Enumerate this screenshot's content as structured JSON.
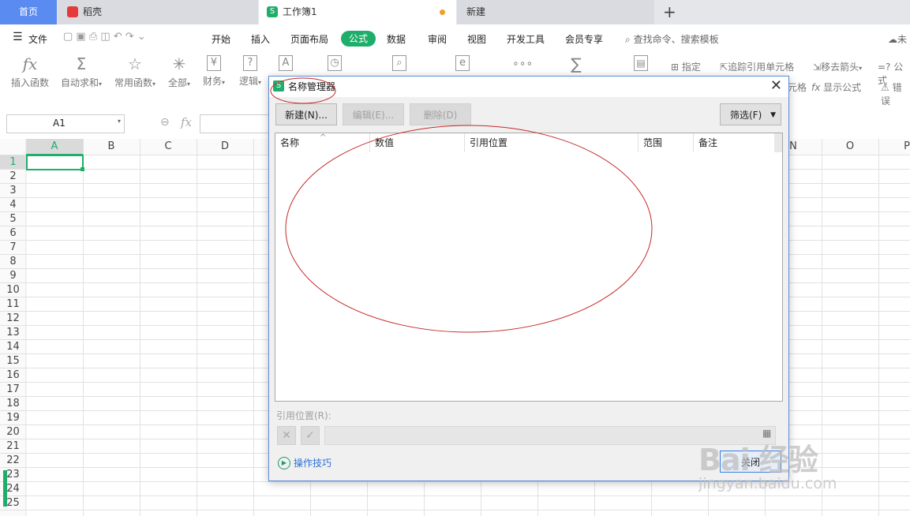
{
  "tabs": {
    "home": "首页",
    "docer": "稻壳",
    "workbook": "工作簿1",
    "new": "新建",
    "add": "+"
  },
  "menu": {
    "file": "文件",
    "items": [
      "开始",
      "插入",
      "页面布局",
      "公式",
      "数据",
      "审阅",
      "视图",
      "开发工具",
      "会员专享"
    ],
    "search": "查找命令、搜索模板",
    "cloud": "未"
  },
  "ribbon": {
    "insert_func": "插入函数",
    "autosum": "自动求和",
    "common_func": "常用函数",
    "all": "全部",
    "finance": "财务",
    "logic": "逻辑",
    "specify": "指定",
    "trace_precedents": "追踪引用单元格",
    "trace_dependents": "元格",
    "remove_arrows": "移去箭头",
    "formula_equals": "=? 公式",
    "show_formulas": "显示公式",
    "error": "错误"
  },
  "formula_bar": {
    "namebox": "A1",
    "fx": "fx"
  },
  "grid": {
    "columns": [
      "A",
      "B",
      "C",
      "D",
      "N",
      "O",
      "P"
    ],
    "rows": [
      "1",
      "2",
      "3",
      "4",
      "5",
      "6",
      "7",
      "8",
      "9",
      "10",
      "11",
      "12",
      "13",
      "14",
      "15",
      "16",
      "17",
      "18",
      "19",
      "20",
      "21",
      "22",
      "23",
      "24",
      "25"
    ]
  },
  "dialog": {
    "title": "名称管理器",
    "new": "新建(N)...",
    "edit": "编辑(E)...",
    "delete": "删除(D)",
    "filter": "筛选(F)",
    "columns": [
      "名称",
      "数值",
      "引用位置",
      "范围",
      "备注"
    ],
    "refers_to_label": "引用位置(R):",
    "tips": "操作技巧",
    "close": "关闭"
  },
  "watermark": {
    "logo": "Bai 经验",
    "url": "jingyan.baidu.com"
  },
  "colors": {
    "accent_green": "#1fae6a",
    "home_tab_blue": "#5a8bf0",
    "annotation_red": "#c62828"
  }
}
